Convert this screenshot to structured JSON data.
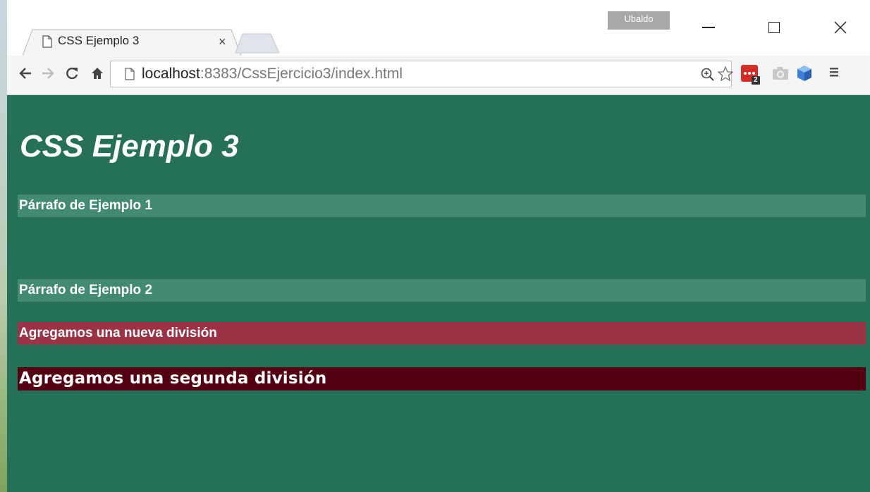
{
  "window": {
    "profile_name": "Ubaldo"
  },
  "tab": {
    "title": "CSS Ejemplo 3",
    "close_glyph": "×"
  },
  "toolbar": {
    "url_host": "localhost",
    "url_rest": ":8383/CssEjercicio3/index.html",
    "lastpass_badge": "2"
  },
  "page": {
    "heading": "CSS Ejemplo 3",
    "paragraph_1": "Párrafo de Ejemplo 1",
    "paragraph_2": "Párrafo de Ejemplo 2",
    "division_1": "Agregamos una nueva división",
    "division_2": "Agregamos una segunda división"
  },
  "colors": {
    "page_background": "#26705a",
    "paragraph_background": "#438a74",
    "division_1_background": "#9b3347",
    "division_2_background": "#540013"
  },
  "icons": [
    "document-icon",
    "back-arrow-icon",
    "forward-arrow-icon",
    "reload-icon",
    "home-icon",
    "zoom-icon",
    "star-icon",
    "lastpass-icon",
    "camera-icon",
    "cube-icon",
    "menu-icon"
  ]
}
